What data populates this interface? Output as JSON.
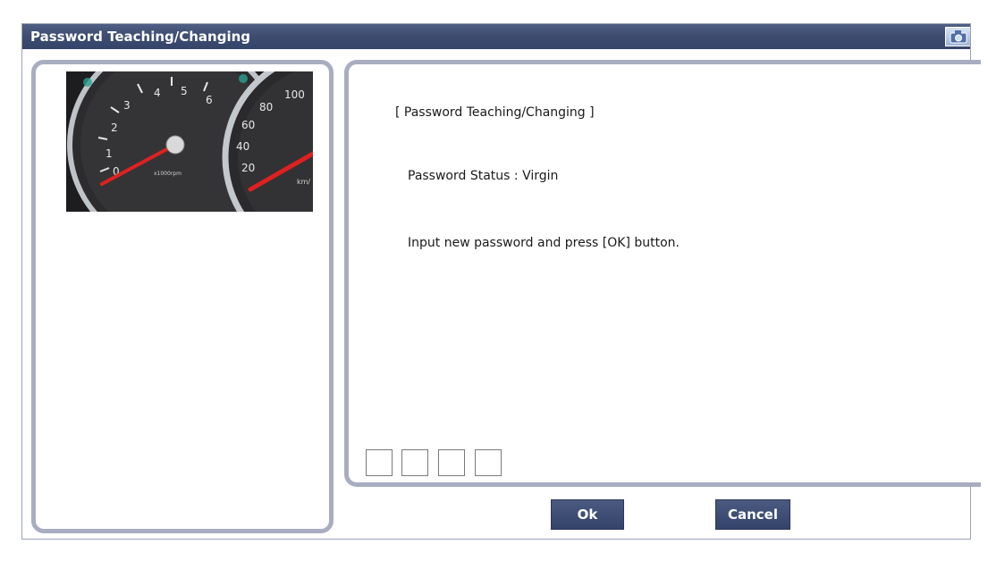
{
  "window": {
    "title": "Password Teaching/Changing"
  },
  "icons": {
    "title_icon": "camera-icon",
    "image": "instrument-cluster-gauge"
  },
  "gauge": {
    "tach_labels": [
      "1",
      "2",
      "3",
      "4",
      "5",
      "6",
      "0"
    ],
    "tach_unit": "x1000rpm",
    "speed_labels": [
      "20",
      "40",
      "60",
      "80",
      "100"
    ],
    "speed_unit": "km/"
  },
  "content": {
    "heading": "[ Password Teaching/Changing ]",
    "status_text": "Password Status : Virgin",
    "instruction": "Input new password and press [OK] button."
  },
  "password": {
    "digits": [
      "",
      "",
      "",
      ""
    ]
  },
  "buttons": {
    "ok_label": "Ok",
    "cancel_label": "Cancel"
  },
  "colors": {
    "titlebar": "#3e4d70",
    "panel_border": "#a8adc0",
    "button": "#3c4b70",
    "needle": "#e02020"
  }
}
